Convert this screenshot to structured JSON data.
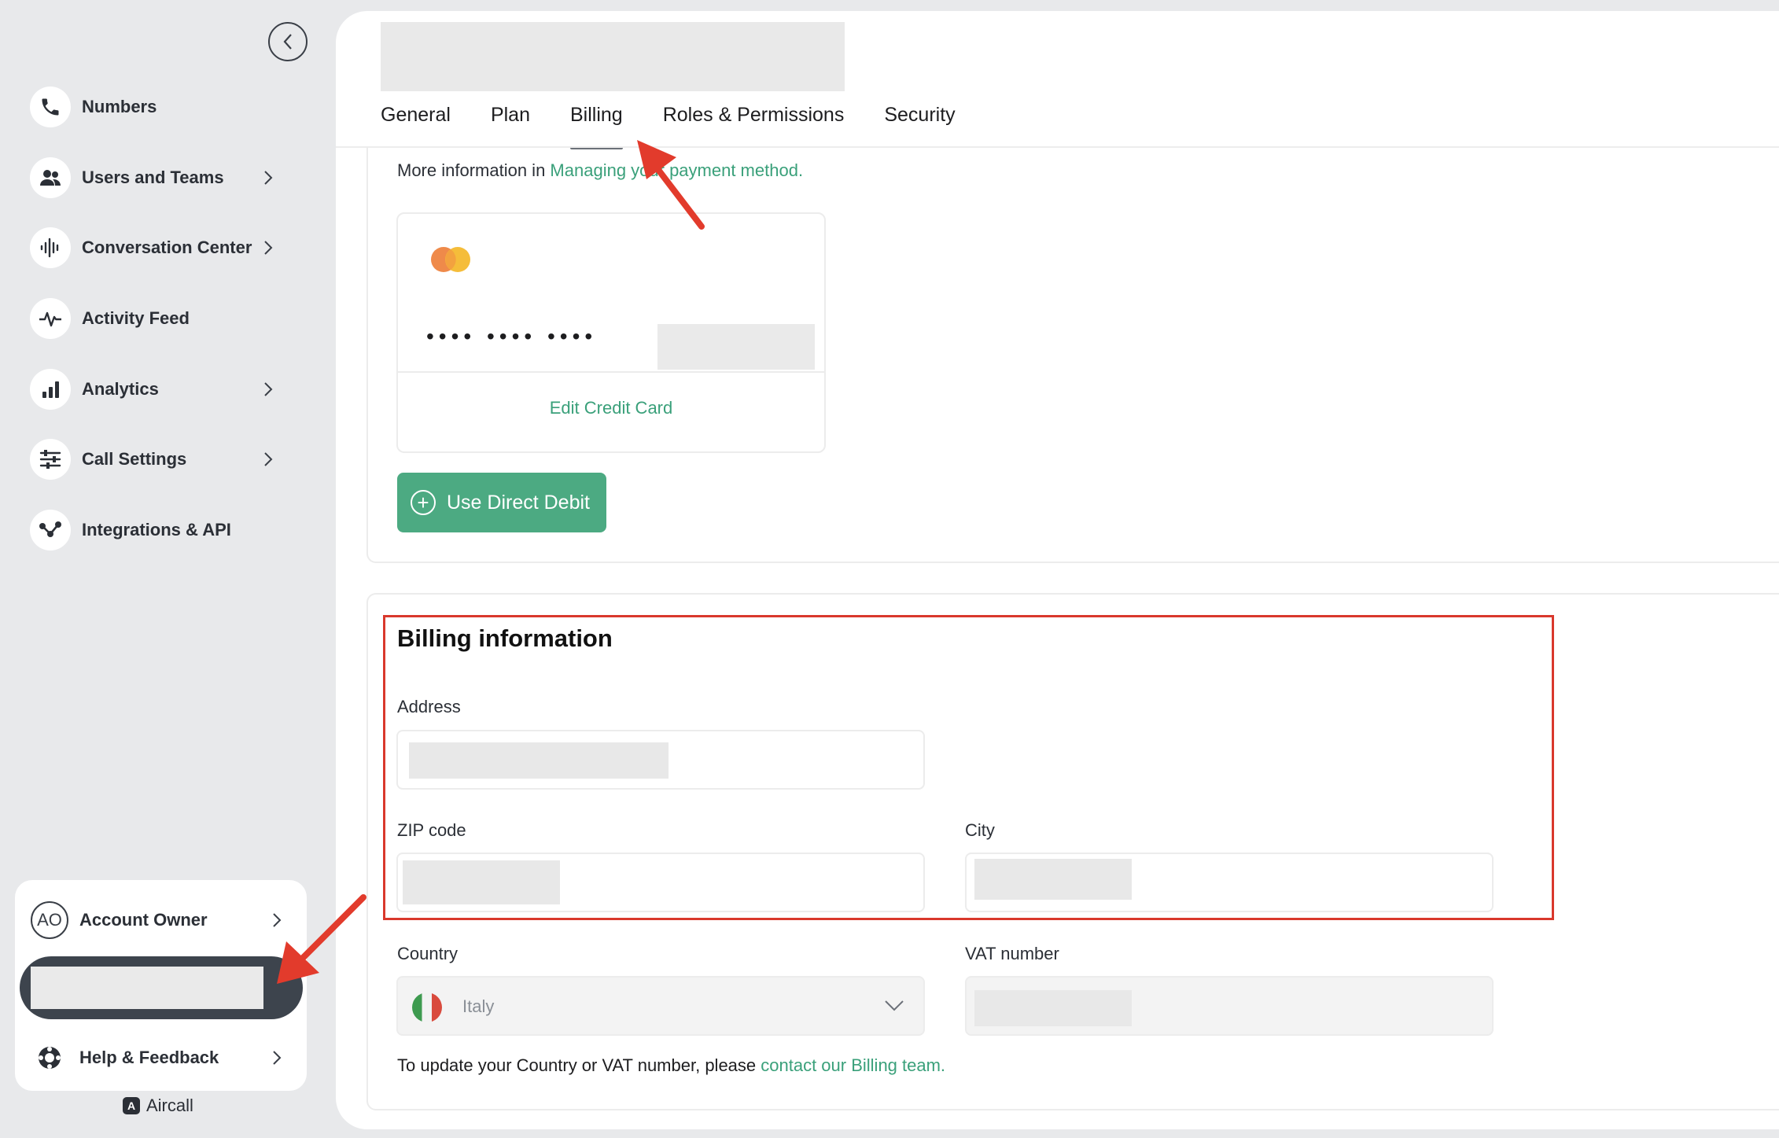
{
  "sidebar": {
    "items": [
      {
        "label": "Numbers",
        "icon": "phone-icon",
        "has_chevron": false
      },
      {
        "label": "Users and Teams",
        "icon": "users-icon",
        "has_chevron": true
      },
      {
        "label": "Conversation Center",
        "icon": "waveform-icon",
        "has_chevron": true
      },
      {
        "label": "Activity Feed",
        "icon": "pulse-icon",
        "has_chevron": false
      },
      {
        "label": "Analytics",
        "icon": "bar-chart-icon",
        "has_chevron": true
      },
      {
        "label": "Call Settings",
        "icon": "sliders-icon",
        "has_chevron": true
      },
      {
        "label": "Integrations & API",
        "icon": "nodes-icon",
        "has_chevron": false
      }
    ],
    "account": {
      "avatar_initials": "AO",
      "label": "Account Owner"
    },
    "help": {
      "label": "Help & Feedback"
    },
    "brand": {
      "name": "Aircall",
      "logo_letter": "A"
    }
  },
  "tabs": [
    {
      "label": "General",
      "active": false
    },
    {
      "label": "Plan",
      "active": false
    },
    {
      "label": "Billing",
      "active": true
    },
    {
      "label": "Roles & Permissions",
      "active": false
    },
    {
      "label": "Security",
      "active": false
    }
  ],
  "payment": {
    "more_info_prefix": "More information in ",
    "more_info_link": "Managing your payment method.",
    "card_mask": "•••• •••• ••••",
    "edit_label": "Edit Credit Card",
    "direct_debit_label": "Use Direct Debit"
  },
  "billing": {
    "title": "Billing information",
    "address_label": "Address",
    "zip_label": "ZIP code",
    "city_label": "City",
    "country_label": "Country",
    "country_value": "Italy",
    "vat_label": "VAT number",
    "note_prefix": "To update your Country or VAT number, please ",
    "note_link": "contact our Billing team."
  },
  "colors": {
    "accent_green": "#4caa82",
    "link_green": "#3aa07a",
    "annotation_red": "#d9382c",
    "sidebar_bg": "#e8e9eb"
  }
}
